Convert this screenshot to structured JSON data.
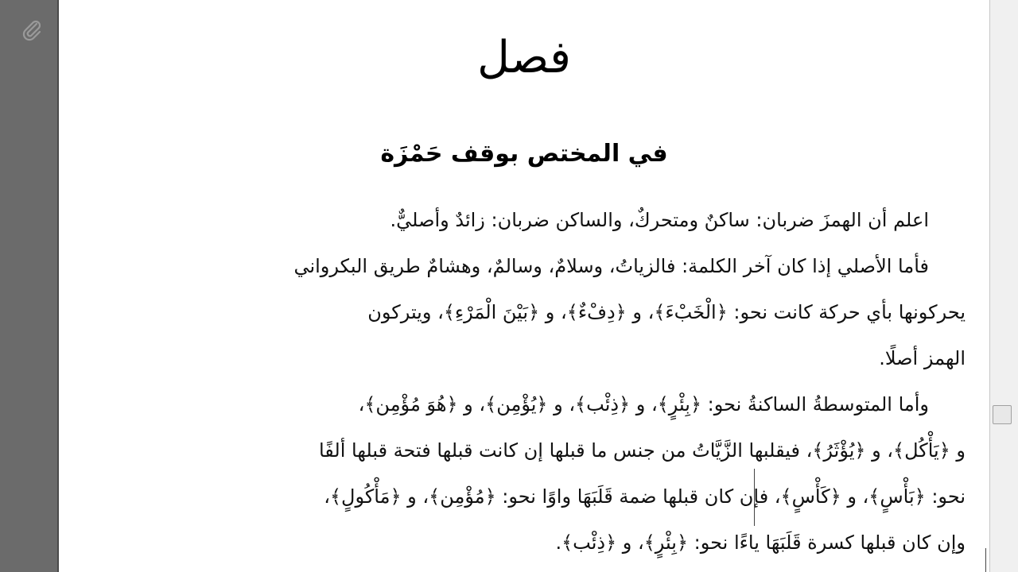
{
  "viewer": {
    "attach_icon": "paperclip-icon",
    "scrollbar": "scroll-thumb"
  },
  "document": {
    "title": "فصل",
    "subtitle": "في المختص بوقف حَمْزَة",
    "paragraphs": [
      [
        "اعلم أن الهمزَ ضربان: ساكنٌ ومتحركٌ، والساكن ضربان: زائدٌ وأصليٌّ."
      ],
      [
        "فأما الأصلي إذا كان آخر الكلمة: فالزياتُ، وسلامٌ، وسالمٌ، وهشامٌ طريق البكرواني",
        "يحركونها بأي حركة كانت نحو: ﴿الْخَبْءَ﴾، و ﴿دِفْءٌ﴾، و ﴿بَيْنَ الْمَرْءِ﴾، ويتركون",
        "الهمز أصلًا."
      ],
      [
        "وأما المتوسطةُ الساكنةُ نحو: ﴿بِئْرٍ﴾، و ﴿ذِئْب﴾، و ﴿يُؤْمِن﴾، و ﴿هُوَ مُؤْمِن﴾،",
        "و ﴿يَأْكُل﴾، و ﴿يُؤْثَرُ﴾، فيقلبها الزَّيَّاتُ من جنس ما قبلها إن كانت قبلها فتحة قبلها ألفًا",
        "نحو: ﴿بَأْسٍ﴾، و ﴿كَأْسٍ﴾، فإن كان قبلها ضمة قَلَبَهَا واوًا نحو: ﴿مُؤْمِن﴾، و ﴿مَأْكُولٍ﴾،",
        "وإن كان قبلها كسرة قَلَبَهَا ياءًا نحو: ﴿بِئْرٍ﴾، و ﴿ذِئْب﴾."
      ]
    ]
  }
}
